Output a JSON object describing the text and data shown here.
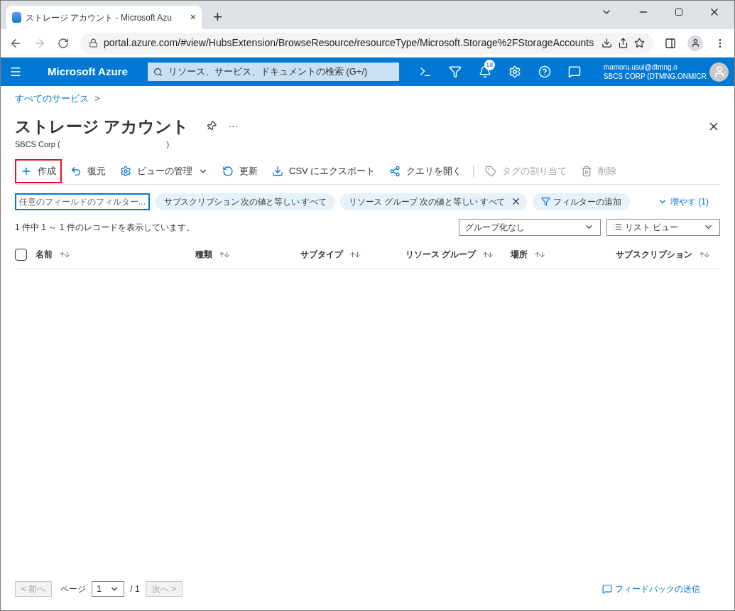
{
  "browser": {
    "tab": {
      "title": "ストレージ アカウント - Microsoft Azu",
      "close": "×"
    },
    "new_tab": "+",
    "url": "portal.azure.com/#view/HubsExtension/BrowseResource/resourceType/Microsoft.Storage%2FStorageAccounts"
  },
  "topbar": {
    "brand": "Microsoft Azure",
    "search": {
      "placeholder": "リソース、サービス、ドキュメントの検索 (G+/)"
    },
    "notifications": "18",
    "user": {
      "email": "mamoru.usui@dtmng.o",
      "tenant": "SBCS CORP (DTMNG.ONMICR"
    }
  },
  "breadcrumb": {
    "label": "すべてのサービス",
    "separator": ">"
  },
  "page": {
    "title": "ストレージ アカウント",
    "more": "···",
    "subtitle_start": "SBCS Corp (",
    "subtitle_end": ")"
  },
  "toolbar": [
    {
      "kind": "create",
      "label": "作成",
      "disabled": false,
      "highlighted": true
    },
    {
      "kind": "restore",
      "label": "復元",
      "disabled": false,
      "highlighted": false
    },
    {
      "kind": "view",
      "label": "ビューの管理",
      "disabled": false,
      "highlighted": false
    },
    {
      "kind": "refresh",
      "label": "更新",
      "disabled": false,
      "highlighted": false
    },
    {
      "kind": "export",
      "label": "CSV にエクスポート",
      "disabled": false,
      "highlighted": false
    },
    {
      "kind": "query",
      "label": "クエリを開く",
      "disabled": false,
      "highlighted": false
    },
    {
      "kind": "tag",
      "label": "タグの割り当て",
      "disabled": true,
      "highlighted": false
    },
    {
      "kind": "delete",
      "label": "削除",
      "disabled": true,
      "highlighted": false
    }
  ],
  "filters": {
    "field": {
      "placeholder": "任意のフィールドのフィルター..."
    },
    "pills": [
      {
        "label": "サブスクリプション 次の値と等しい すべて",
        "removable": false
      },
      {
        "label": "リソース グループ 次の値と等しい すべて",
        "removable": true
      }
    ],
    "add": "フィルターの追加",
    "more": "増やす (1)"
  },
  "records": "1 件中 1 ～ 1 件のレコードを表示しています。",
  "grouping": "グループ化なし",
  "view": "リスト ビュー",
  "table": {
    "select_all": {
      "checked": false
    },
    "columns": [
      "名前",
      "種類",
      "サブタイプ",
      "リソース グループ",
      "場所",
      "サブスクリプション"
    ]
  },
  "pager": {
    "prev": "< 前へ",
    "page_label": "ページ",
    "page": "1",
    "total": "/ 1",
    "next": "次へ >"
  },
  "feedback": "フィードバックの送信"
}
